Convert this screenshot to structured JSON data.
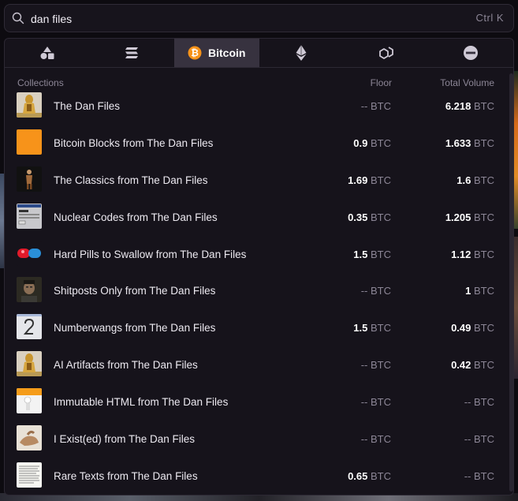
{
  "search": {
    "value": "dan files",
    "shortcut": "Ctrl K"
  },
  "tabs": [
    {
      "label": "",
      "icon": "shapes-icon"
    },
    {
      "label": "",
      "icon": "solana-icon"
    },
    {
      "label": "Bitcoin",
      "icon": "bitcoin-icon",
      "active": true
    },
    {
      "label": "",
      "icon": "ethereum-icon"
    },
    {
      "label": "",
      "icon": "polygon-icon"
    },
    {
      "label": "",
      "icon": "minus-circle-icon"
    }
  ],
  "columns": {
    "collections": "Collections",
    "floor": "Floor",
    "total_volume": "Total Volume"
  },
  "unit": "BTC",
  "accent_colors": {
    "bitcoin": "#f7931a",
    "active_tab": "#37323f"
  },
  "collections": [
    {
      "name": "The Dan Files",
      "floor": "--",
      "volume": "6.218",
      "thumb": "golden-figure"
    },
    {
      "name": "Bitcoin Blocks from The Dan Files",
      "floor": "0.9",
      "volume": "1.633",
      "thumb": "orange-square"
    },
    {
      "name": "The Classics from The Dan Files",
      "floor": "1.69",
      "volume": "1.6",
      "thumb": "dark-figure"
    },
    {
      "name": "Nuclear Codes from The Dan Files",
      "floor": "0.35",
      "volume": "1.205",
      "thumb": "window-screen"
    },
    {
      "name": "Hard Pills to Swallow from The Dan Files",
      "floor": "1.5",
      "volume": "1.12",
      "thumb": "red-blue-pill"
    },
    {
      "name": "Shitposts Only from The Dan Files",
      "floor": "--",
      "volume": "1",
      "thumb": "portrait"
    },
    {
      "name": "Numberwangs from The Dan Files",
      "floor": "1.5",
      "volume": "0.49",
      "thumb": "number-two"
    },
    {
      "name": "AI Artifacts from The Dan Files",
      "floor": "--",
      "volume": "0.42",
      "thumb": "golden-figure"
    },
    {
      "name": "Immutable HTML from The Dan Files",
      "floor": "--",
      "volume": "--",
      "thumb": "html-page"
    },
    {
      "name": "I Exist(ed) from The Dan Files",
      "floor": "--",
      "volume": "--",
      "thumb": "hand"
    },
    {
      "name": "Rare Texts from The Dan Files",
      "floor": "0.65",
      "volume": "--",
      "thumb": "text-page"
    }
  ]
}
